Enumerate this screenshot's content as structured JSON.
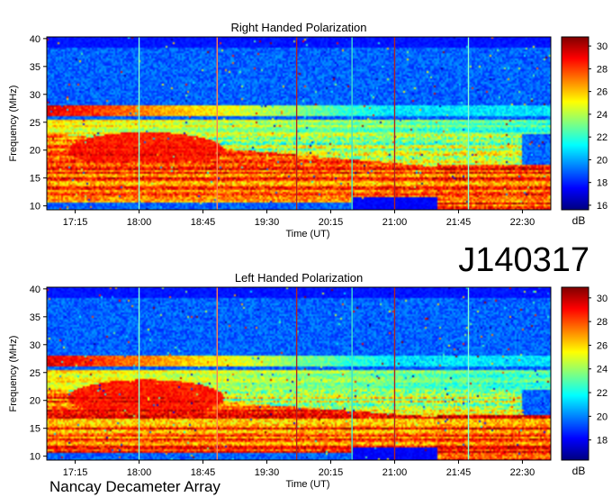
{
  "figure": {
    "event_id": "J140317",
    "instrument": "Nancay Decameter Array"
  },
  "chart_data": [
    {
      "type": "heatmap",
      "title": "Right Handed Polarization",
      "xlabel": "Time (UT)",
      "ylabel": "Frequency (MHz)",
      "xticks": [
        "17:15",
        "18:00",
        "18:45",
        "19:30",
        "20:15",
        "21:00",
        "21:45",
        "22:30"
      ],
      "xlim": [
        "16:55",
        "22:50"
      ],
      "yticks": [
        10,
        15,
        20,
        25,
        30,
        35,
        40
      ],
      "ylim": [
        9.3,
        40.3
      ],
      "colorbar": {
        "label": "dB",
        "ticks": [
          16,
          18,
          20,
          22,
          24,
          26,
          28,
          30
        ],
        "range": [
          15.6,
          30.8
        ]
      },
      "vertical_lines": [
        {
          "time": "18:00",
          "color": "#7fffd4"
        },
        {
          "time": "18:55",
          "color": "#ff7f50"
        },
        {
          "time": "19:51",
          "color": "#b22222"
        },
        {
          "time": "20:30",
          "color": "#40e0d0"
        },
        {
          "time": "21:00",
          "color": "#b22222"
        },
        {
          "time": "21:52",
          "color": "#7fffd4"
        }
      ],
      "features": {
        "storm_dense_band_mhz": [
          10.5,
          23
        ],
        "storm_arc_peak": {
          "time": "18:05",
          "freq": 22
        },
        "mid_band_mhz": [
          26,
          28
        ],
        "storm_end_time": "21:30"
      }
    },
    {
      "type": "heatmap",
      "title": "Left Handed Polarization",
      "xlabel": "Time (UT)",
      "ylabel": "Frequency (MHz)",
      "xticks": [
        "17:15",
        "18:00",
        "18:45",
        "19:30",
        "20:15",
        "21:00",
        "21:45",
        "22:30"
      ],
      "xlim": [
        "16:55",
        "22:50"
      ],
      "yticks": [
        10,
        15,
        20,
        25,
        30,
        35,
        40
      ],
      "ylim": [
        9.3,
        40.3
      ],
      "colorbar": {
        "label": "dB",
        "ticks": [
          18,
          20,
          22,
          24,
          26,
          28,
          30
        ],
        "range": [
          16.3,
          30.9
        ]
      },
      "vertical_lines": [
        {
          "time": "18:00",
          "color": "#7fffd4"
        },
        {
          "time": "18:55",
          "color": "#ff7f50"
        },
        {
          "time": "19:51",
          "color": "#b22222"
        },
        {
          "time": "20:30",
          "color": "#40e0d0"
        },
        {
          "time": "21:00",
          "color": "#b22222"
        },
        {
          "time": "21:52",
          "color": "#7fffd4"
        }
      ],
      "features": {
        "storm_dense_band_mhz": [
          10.5,
          22
        ],
        "storm_arc_peak": {
          "time": "18:05",
          "freq": 22.5
        },
        "mid_band_mhz": [
          26,
          28
        ],
        "storm_end_time": "21:30"
      }
    }
  ]
}
